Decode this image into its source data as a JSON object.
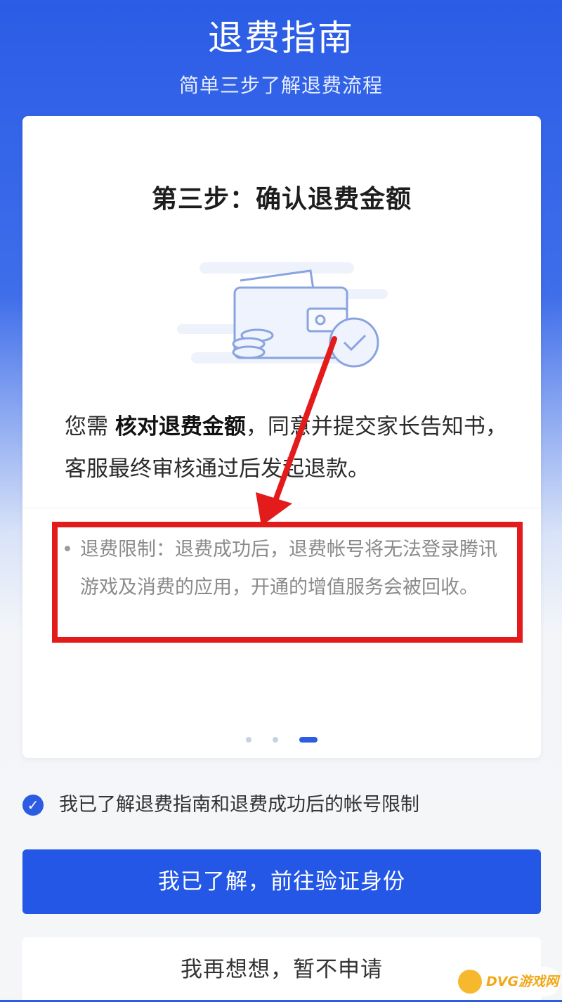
{
  "header": {
    "title": "退费指南",
    "subtitle": "简单三步了解退费流程"
  },
  "card": {
    "step_title": "第三步：确认退费金额",
    "desc_prefix": "您需 ",
    "desc_emphasis": "核对退费金额",
    "desc_suffix": "，同意并提交家长告知书，客服最终审核通过后发起退款。",
    "limit_text": "退费限制：退费成功后，退费帐号将无法登录腾讯游戏及消费的应用，开通的增值服务会被回收。",
    "pager": {
      "total": 3,
      "active_index": 3
    }
  },
  "agreement": {
    "checked": true,
    "label": "我已了解退费指南和退费成功后的帐号限制"
  },
  "buttons": {
    "primary_label": "我已了解，前往验证身份",
    "secondary_label": "我再想想，暂不申请"
  },
  "watermark": {
    "text": "DVG游戏网"
  },
  "colors": {
    "brand_blue": "#2457e6",
    "annotation_red": "#e31b1b",
    "watermark_orange": "#f2a718"
  }
}
